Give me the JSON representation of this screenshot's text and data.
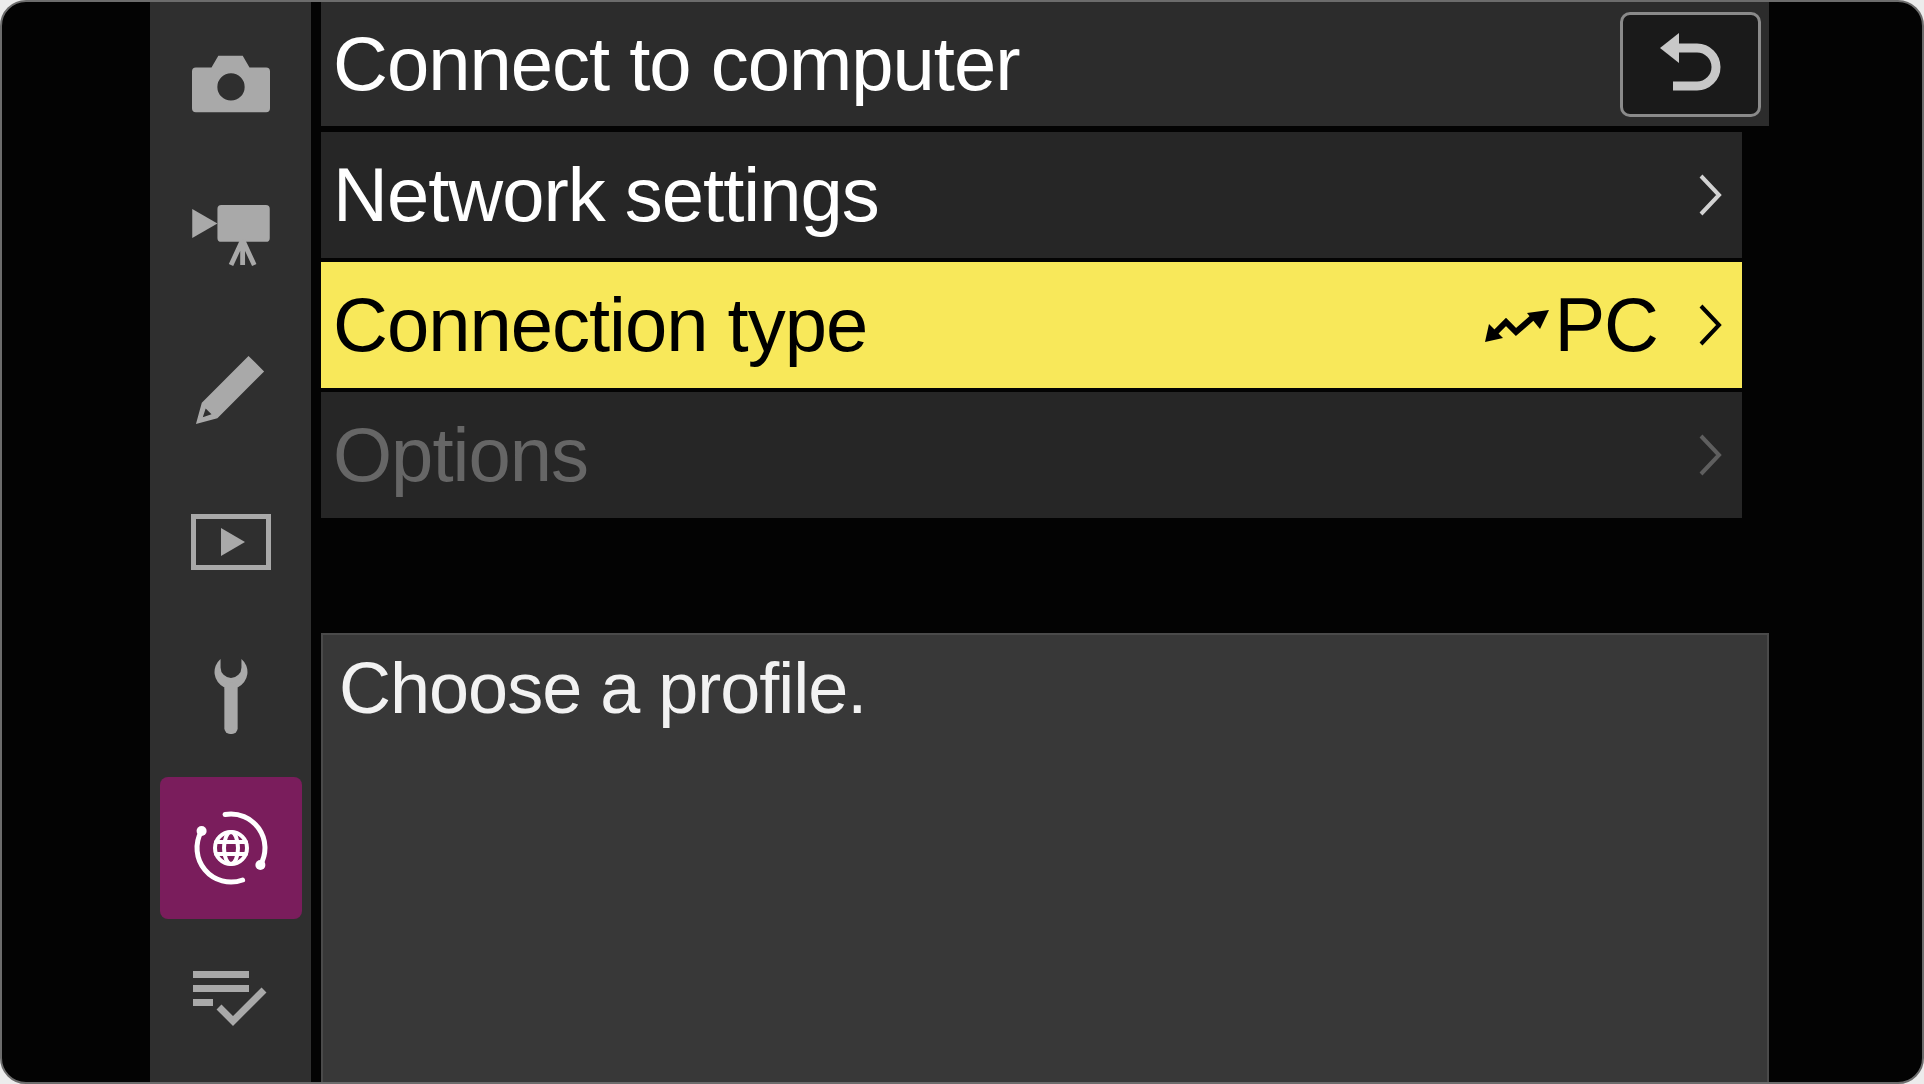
{
  "sidebar": {
    "tabs": [
      {
        "kind": "camera",
        "selected": false
      },
      {
        "kind": "movie",
        "selected": false
      },
      {
        "kind": "pencil",
        "selected": false
      },
      {
        "kind": "playback",
        "selected": false
      },
      {
        "kind": "wrench",
        "selected": false
      },
      {
        "kind": "network",
        "selected": true
      },
      {
        "kind": "checklist",
        "selected": false
      }
    ]
  },
  "header": {
    "title": "Connect to computer"
  },
  "menu": {
    "items": [
      {
        "label": "Network settings",
        "selected": false,
        "disabled": false
      },
      {
        "label": "Connection type",
        "value": "PC",
        "selected": true,
        "disabled": false
      },
      {
        "label": "Options",
        "selected": false,
        "disabled": true
      }
    ]
  },
  "help": {
    "text": "Choose a profile."
  }
}
